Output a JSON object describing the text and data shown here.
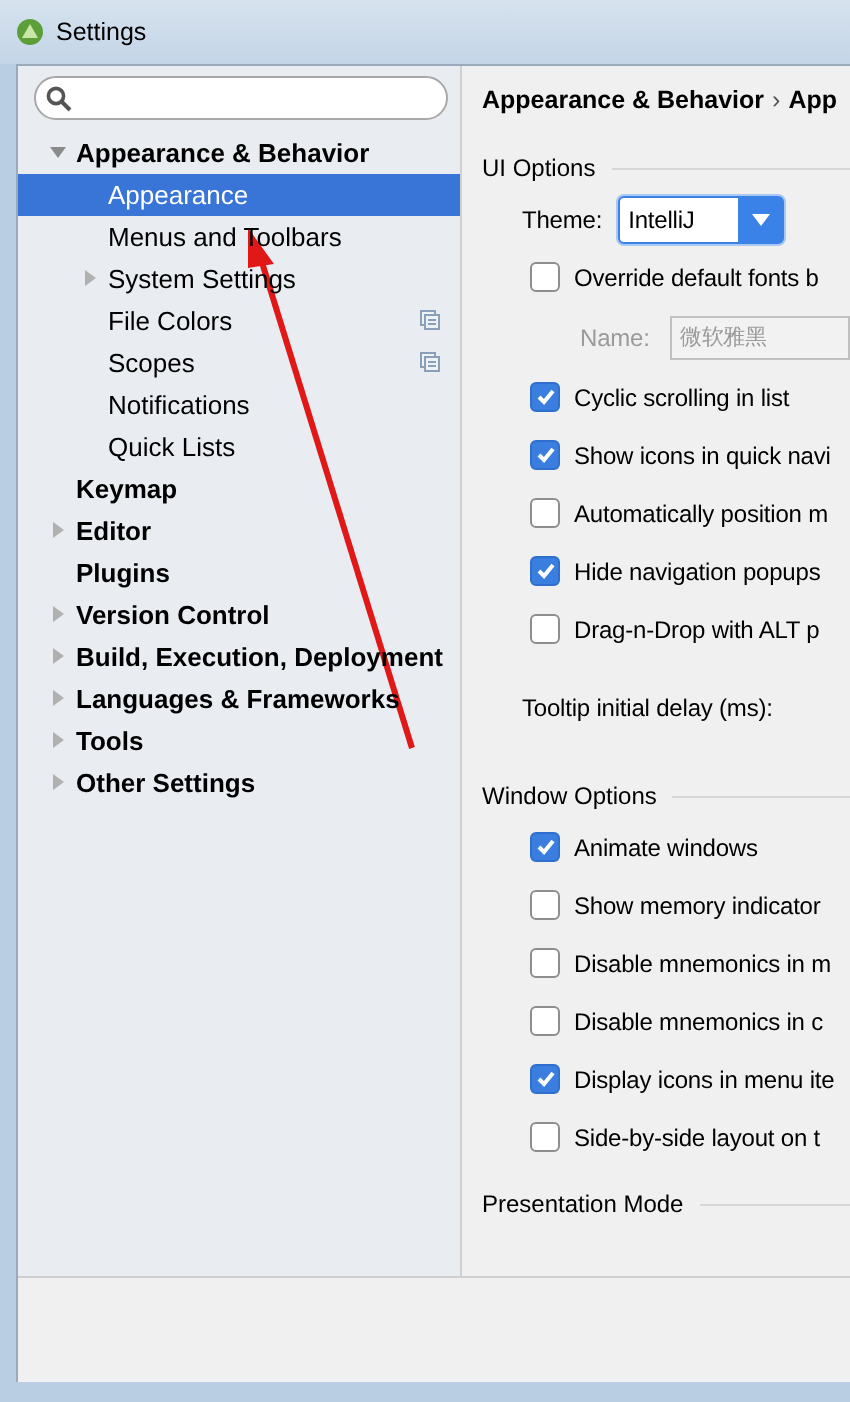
{
  "window": {
    "title": "Settings"
  },
  "tree": [
    {
      "label": "Appearance & Behavior",
      "expanded": true,
      "selected": false,
      "per_project": false,
      "children": [
        {
          "label": "Appearance",
          "selected": true,
          "per_project": false
        },
        {
          "label": "Menus and Toolbars",
          "selected": false,
          "per_project": false
        },
        {
          "label": "System Settings",
          "expanded": false,
          "selected": false,
          "per_project": false
        },
        {
          "label": "File Colors",
          "selected": false,
          "per_project": true
        },
        {
          "label": "Scopes",
          "selected": false,
          "per_project": true
        },
        {
          "label": "Notifications",
          "selected": false,
          "per_project": false
        },
        {
          "label": "Quick Lists",
          "selected": false,
          "per_project": false
        }
      ]
    },
    {
      "label": "Keymap",
      "selected": false,
      "per_project": false
    },
    {
      "label": "Editor",
      "expanded": false,
      "selected": false,
      "per_project": false
    },
    {
      "label": "Plugins",
      "selected": false,
      "per_project": false
    },
    {
      "label": "Version Control",
      "expanded": false,
      "selected": false,
      "per_project": false
    },
    {
      "label": "Build, Execution, Deployment",
      "expanded": false,
      "selected": false,
      "per_project": false
    },
    {
      "label": "Languages & Frameworks",
      "expanded": false,
      "selected": false,
      "per_project": false
    },
    {
      "label": "Tools",
      "expanded": false,
      "selected": false,
      "per_project": false
    },
    {
      "label": "Other Settings",
      "expanded": false,
      "selected": false,
      "per_project": false
    }
  ],
  "breadcrumb": {
    "items": [
      "Appearance & Behavior",
      "App"
    ],
    "separator": "›"
  },
  "sections": [
    {
      "title": "UI Options",
      "rows": [
        {
          "kind": "dropdown",
          "label": "Theme:",
          "value": "IntelliJ"
        },
        {
          "kind": "checkbox",
          "label": "Override default fonts b",
          "checked": false
        },
        {
          "kind": "font",
          "label": "Name:",
          "value": "微软雅黑",
          "disabled": true
        },
        {
          "kind": "checkbox",
          "label": "Cyclic scrolling in list",
          "checked": true
        },
        {
          "kind": "checkbox",
          "label": "Show icons in quick navi",
          "checked": true
        },
        {
          "kind": "checkbox",
          "label": "Automatically position m",
          "checked": false
        },
        {
          "kind": "checkbox",
          "label": "Hide navigation popups",
          "checked": true
        },
        {
          "kind": "checkbox",
          "label": "Drag-n-Drop with ALT p",
          "checked": false
        },
        {
          "kind": "text",
          "label": "Tooltip initial delay (ms):"
        }
      ]
    },
    {
      "title": "Window Options",
      "rows": [
        {
          "kind": "checkbox",
          "label": "Animate windows",
          "checked": true
        },
        {
          "kind": "checkbox",
          "label": "Show memory indicator",
          "checked": false
        },
        {
          "kind": "checkbox",
          "label": "Disable mnemonics in m",
          "checked": false
        },
        {
          "kind": "checkbox",
          "label": "Disable mnemonics in c",
          "checked": false
        },
        {
          "kind": "checkbox",
          "label": "Display icons in menu ite",
          "checked": true
        },
        {
          "kind": "checkbox",
          "label": "Side-by-side layout on t",
          "checked": false
        }
      ]
    },
    {
      "title": "Presentation Mode"
    }
  ]
}
